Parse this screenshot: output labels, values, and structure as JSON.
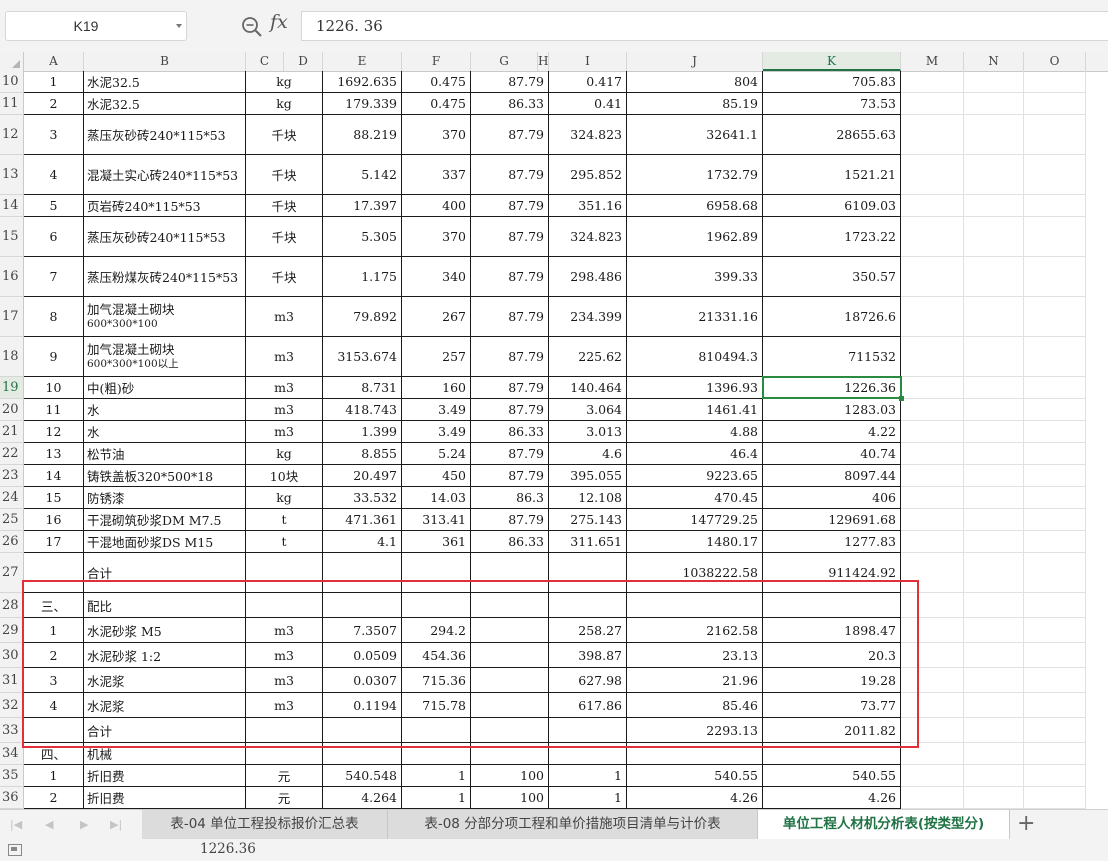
{
  "formula_bar": {
    "cell_ref": "K19",
    "formula": "1226. 36",
    "zoom_icon": "zoom-icon",
    "fx_label": "fx"
  },
  "columns": [
    "A",
    "B",
    "C",
    "D",
    "E",
    "F",
    "G",
    "H",
    "I",
    "J",
    "K",
    "M",
    "N",
    "O"
  ],
  "selected_column": "K",
  "rows": [
    {
      "num": "10",
      "a": "1",
      "b": "水泥32.5",
      "c": "kg",
      "e": "1692.635",
      "f": "0.475",
      "g": "87.79",
      "i": "0.417",
      "j": "804",
      "k": "705.83"
    },
    {
      "num": "11",
      "a": "2",
      "b": "水泥32.5",
      "c": "kg",
      "e": "179.339",
      "f": "0.475",
      "g": "86.33",
      "i": "0.41",
      "j": "85.19",
      "k": "73.53"
    },
    {
      "num": "12",
      "a": "3",
      "b": "蒸压灰砂砖240*115*53",
      "c": "千块",
      "e": "88.219",
      "f": "370",
      "g": "87.79",
      "i": "324.823",
      "j": "32641.1",
      "k": "28655.63"
    },
    {
      "num": "13",
      "a": "4",
      "b": "混凝土实心砖240*115*53",
      "c": "千块",
      "e": "5.142",
      "f": "337",
      "g": "87.79",
      "i": "295.852",
      "j": "1732.79",
      "k": "1521.21"
    },
    {
      "num": "14",
      "a": "5",
      "b": "页岩砖240*115*53",
      "c": "千块",
      "e": "17.397",
      "f": "400",
      "g": "87.79",
      "i": "351.16",
      "j": "6958.68",
      "k": "6109.03"
    },
    {
      "num": "15",
      "a": "6",
      "b": "蒸压灰砂砖240*115*53",
      "c": "千块",
      "e": "5.305",
      "f": "370",
      "g": "87.79",
      "i": "324.823",
      "j": "1962.89",
      "k": "1723.22"
    },
    {
      "num": "16",
      "a": "7",
      "b": "蒸压粉煤灰砖240*115*53",
      "c": "千块",
      "e": "1.175",
      "f": "340",
      "g": "87.79",
      "i": "298.486",
      "j": "399.33",
      "k": "350.57"
    },
    {
      "num": "17",
      "a": "8",
      "b": "加气混凝土砌块",
      "b2": "600*300*100",
      "c": "m3",
      "e": "79.892",
      "f": "267",
      "g": "87.79",
      "i": "234.399",
      "j": "21331.16",
      "k": "18726.6"
    },
    {
      "num": "18",
      "a": "9",
      "b": "加气混凝土砌块",
      "b2": "600*300*100以上",
      "c": "m3",
      "e": "3153.674",
      "f": "257",
      "g": "87.79",
      "i": "225.62",
      "j": "810494.3",
      "k": "711532"
    },
    {
      "num": "19",
      "a": "10",
      "b": "中(粗)砂",
      "c": "m3",
      "e": "8.731",
      "f": "160",
      "g": "87.79",
      "i": "140.464",
      "j": "1396.93",
      "k": "1226.36"
    },
    {
      "num": "20",
      "a": "11",
      "b": "水",
      "c": "m3",
      "e": "418.743",
      "f": "3.49",
      "g": "87.79",
      "i": "3.064",
      "j": "1461.41",
      "k": "1283.03"
    },
    {
      "num": "21",
      "a": "12",
      "b": "水",
      "c": "m3",
      "e": "1.399",
      "f": "3.49",
      "g": "86.33",
      "i": "3.013",
      "j": "4.88",
      "k": "4.22"
    },
    {
      "num": "22",
      "a": "13",
      "b": "松节油",
      "c": "kg",
      "e": "8.855",
      "f": "5.24",
      "g": "87.79",
      "i": "4.6",
      "j": "46.4",
      "k": "40.74"
    },
    {
      "num": "23",
      "a": "14",
      "b": "铸铁盖板320*500*18",
      "c": "10块",
      "e": "20.497",
      "f": "450",
      "g": "87.79",
      "i": "395.055",
      "j": "9223.65",
      "k": "8097.44"
    },
    {
      "num": "24",
      "a": "15",
      "b": "防锈漆",
      "c": "kg",
      "e": "33.532",
      "f": "14.03",
      "g": "86.3",
      "i": "12.108",
      "j": "470.45",
      "k": "406"
    },
    {
      "num": "25",
      "a": "16",
      "b": "干混砌筑砂浆DM M7.5",
      "c": "t",
      "e": "471.361",
      "f": "313.41",
      "g": "87.79",
      "i": "275.143",
      "j": "147729.25",
      "k": "129691.68"
    },
    {
      "num": "26",
      "a": "17",
      "b": "干混地面砂浆DS M15",
      "c": "t",
      "e": "4.1",
      "f": "361",
      "g": "86.33",
      "i": "311.651",
      "j": "1480.17",
      "k": "1277.83"
    },
    {
      "num": "27",
      "a": "",
      "b": "合计",
      "c": "",
      "e": "",
      "f": "",
      "g": "",
      "i": "",
      "j": "1038222.58",
      "k": "911424.92"
    },
    {
      "num": "28",
      "a": "三、",
      "b": "配比",
      "c": "",
      "e": "",
      "f": "",
      "g": "",
      "i": "",
      "j": "",
      "k": ""
    },
    {
      "num": "29",
      "a": "1",
      "b": "水泥砂浆 M5",
      "c": "m3",
      "e": "7.3507",
      "f": "294.2",
      "g": "",
      "i": "258.27",
      "j": "2162.58",
      "k": "1898.47"
    },
    {
      "num": "30",
      "a": "2",
      "b": "水泥砂浆 1:2",
      "c": "m3",
      "e": "0.0509",
      "f": "454.36",
      "g": "",
      "i": "398.87",
      "j": "23.13",
      "k": "20.3"
    },
    {
      "num": "31",
      "a": "3",
      "b": "水泥浆",
      "c": "m3",
      "e": "0.0307",
      "f": "715.36",
      "g": "",
      "i": "627.98",
      "j": "21.96",
      "k": "19.28"
    },
    {
      "num": "32",
      "a": "4",
      "b": "水泥浆",
      "c": "m3",
      "e": "0.1194",
      "f": "715.78",
      "g": "",
      "i": "617.86",
      "j": "85.46",
      "k": "73.77"
    },
    {
      "num": "33",
      "a": "",
      "b": "合计",
      "c": "",
      "e": "",
      "f": "",
      "g": "",
      "i": "",
      "j": "2293.13",
      "k": "2011.82"
    },
    {
      "num": "34",
      "a": "四、",
      "b": "机械",
      "c": "",
      "e": "",
      "f": "",
      "g": "",
      "i": "",
      "j": "",
      "k": ""
    },
    {
      "num": "35",
      "a": "1",
      "b": "折旧费",
      "c": "元",
      "e": "540.548",
      "f": "1",
      "g": "100",
      "i": "1",
      "j": "540.55",
      "k": "540.55"
    },
    {
      "num": "36",
      "a": "2",
      "b": "折旧费",
      "c": "元",
      "e": "4.264",
      "f": "1",
      "g": "100",
      "i": "1",
      "j": "4.26",
      "k": "4.26"
    }
  ],
  "tabs": [
    {
      "label": "表-04 单位工程投标报价汇总表",
      "active": false
    },
    {
      "label": "表-08 分部分项工程和单价措施项目清单与计价表",
      "active": false
    },
    {
      "label": "单位工程人材机分析表(按类型分)",
      "active": true
    }
  ],
  "add_tab_label": "+",
  "status_bar": {
    "value": "1226.36"
  },
  "highlight_color": "#e0313a",
  "accent_color": "#217346"
}
